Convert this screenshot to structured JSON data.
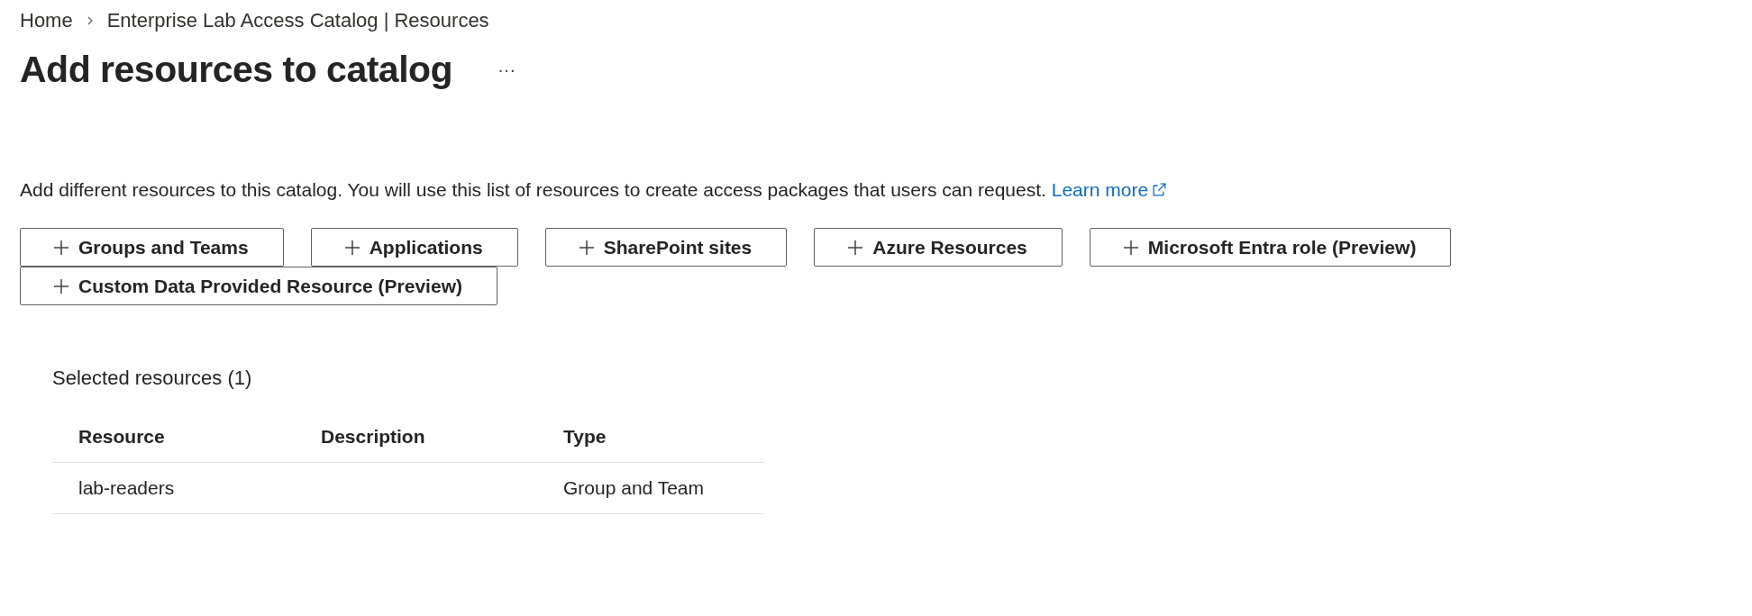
{
  "breadcrumb": [
    "Home",
    "Enterprise Lab Access Catalog | Resources"
  ],
  "title": "Add resources to catalog",
  "more_button": "···",
  "description": "Add different resources to this catalog. You will use this list of resources to create access packages that users can request.",
  "learn_more": "Learn more",
  "add_buttons": [
    "Groups and Teams",
    "Applications",
    "SharePoint sites",
    "Azure Resources",
    "Microsoft Entra role (Preview)",
    "Custom Data Provided Resource (Preview)"
  ],
  "selected_heading": "Selected resources (1)",
  "table": {
    "columns": [
      "Resource",
      "Description",
      "Type"
    ],
    "rows": [
      [
        "lab-readers",
        "",
        "Group and Team"
      ]
    ]
  }
}
